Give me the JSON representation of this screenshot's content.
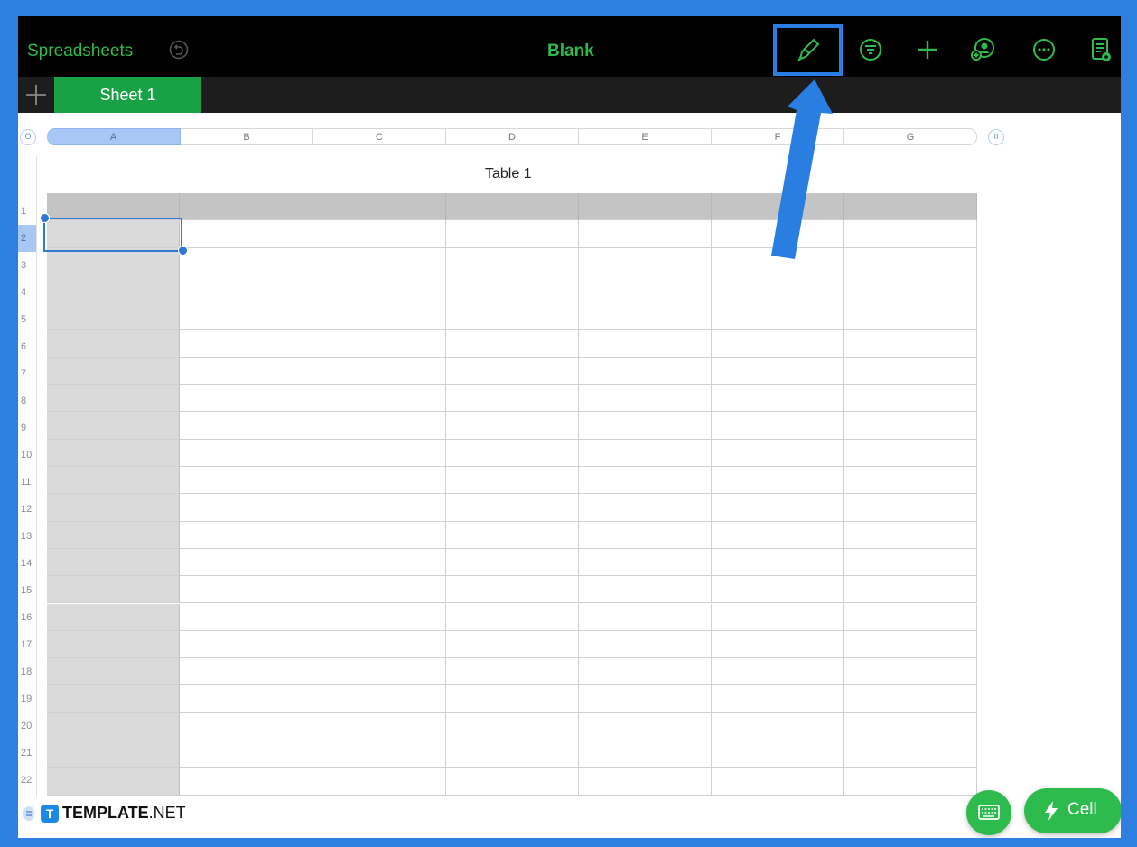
{
  "toolbar": {
    "back_label": "Spreadsheets",
    "title": "Blank",
    "icons": [
      "undo-icon",
      "format-brush-icon",
      "filter-icon",
      "add-icon",
      "collaborate-icon",
      "more-icon",
      "document-view-icon"
    ]
  },
  "tabs": {
    "sheets": [
      {
        "label": "Sheet 1",
        "selected": true
      }
    ]
  },
  "table": {
    "title": "Table 1",
    "columns": [
      "A",
      "B",
      "C",
      "D",
      "E",
      "F",
      "G"
    ],
    "rows": [
      "1",
      "2",
      "3",
      "4",
      "5",
      "6",
      "7",
      "8",
      "9",
      "10",
      "11",
      "12",
      "13",
      "14",
      "15",
      "16",
      "17",
      "18",
      "19",
      "20",
      "21",
      "22"
    ],
    "selected_cell": "A2",
    "col_handle_label": "O",
    "col_handle_right_label": "II"
  },
  "bottom": {
    "watermark_brand": "TEMPLATE",
    "watermark_suffix": ".NET",
    "cell_button_label": "Cell"
  },
  "colors": {
    "accent_green": "#2ebb4e",
    "highlight_blue": "#2a7de1",
    "frame_blue": "#2f7fe0"
  }
}
